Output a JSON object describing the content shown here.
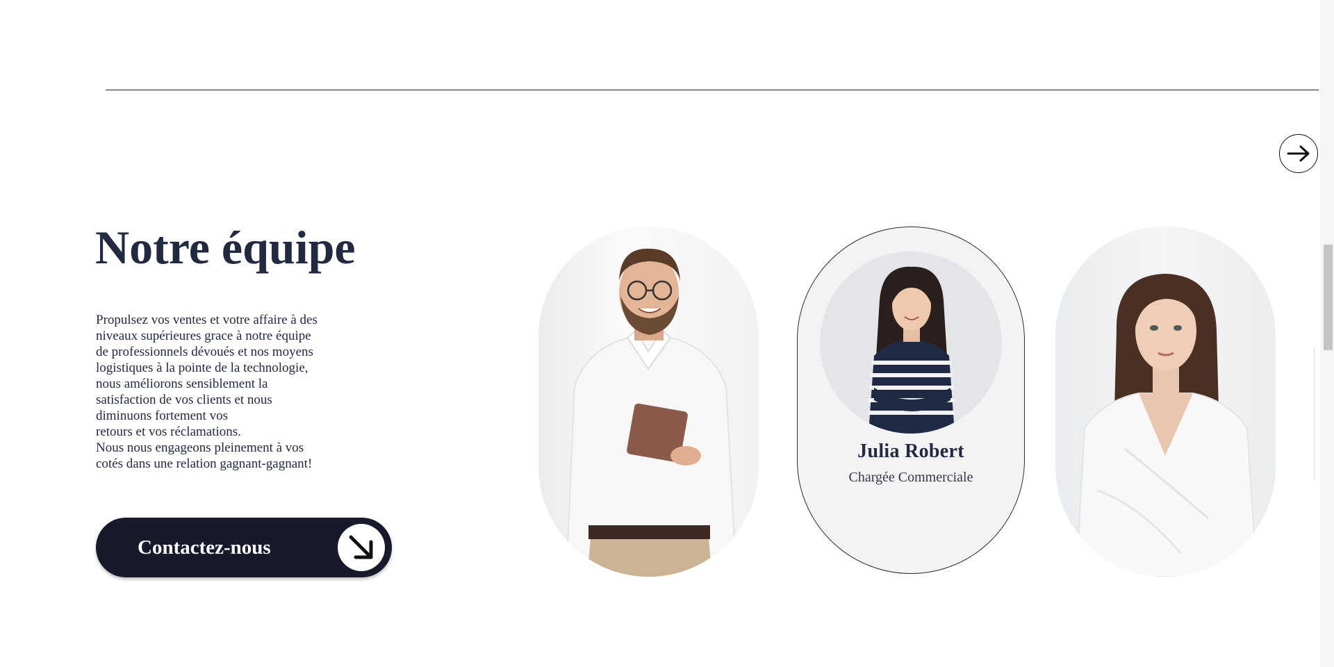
{
  "section": {
    "title": "Notre équipe",
    "description": [
      "Propulsez vos ventes et votre affaire à des",
      "niveaux supérieures grace à notre équipe",
      "de professionnels dévoués et nos moyens",
      "logistiques à la pointe de la technologie,",
      "nous améliorons sensiblement la",
      "satisfaction de vos clients et nous",
      "diminuons fortement vos",
      "retours et vos réclamations.",
      "Nous nous engageons pleinement à vos",
      "cotés dans une relation gagnant-gagnant!"
    ],
    "contact_button": "Contactez-nous"
  },
  "carousel": {
    "next_icon": "arrow-right-icon",
    "active_member": {
      "name": "Julia Robert",
      "role": "Chargée Commerciale"
    }
  },
  "colors": {
    "title": "#222a41",
    "button_bg": "#171a2b",
    "card_bg": "#f3f3f3"
  }
}
